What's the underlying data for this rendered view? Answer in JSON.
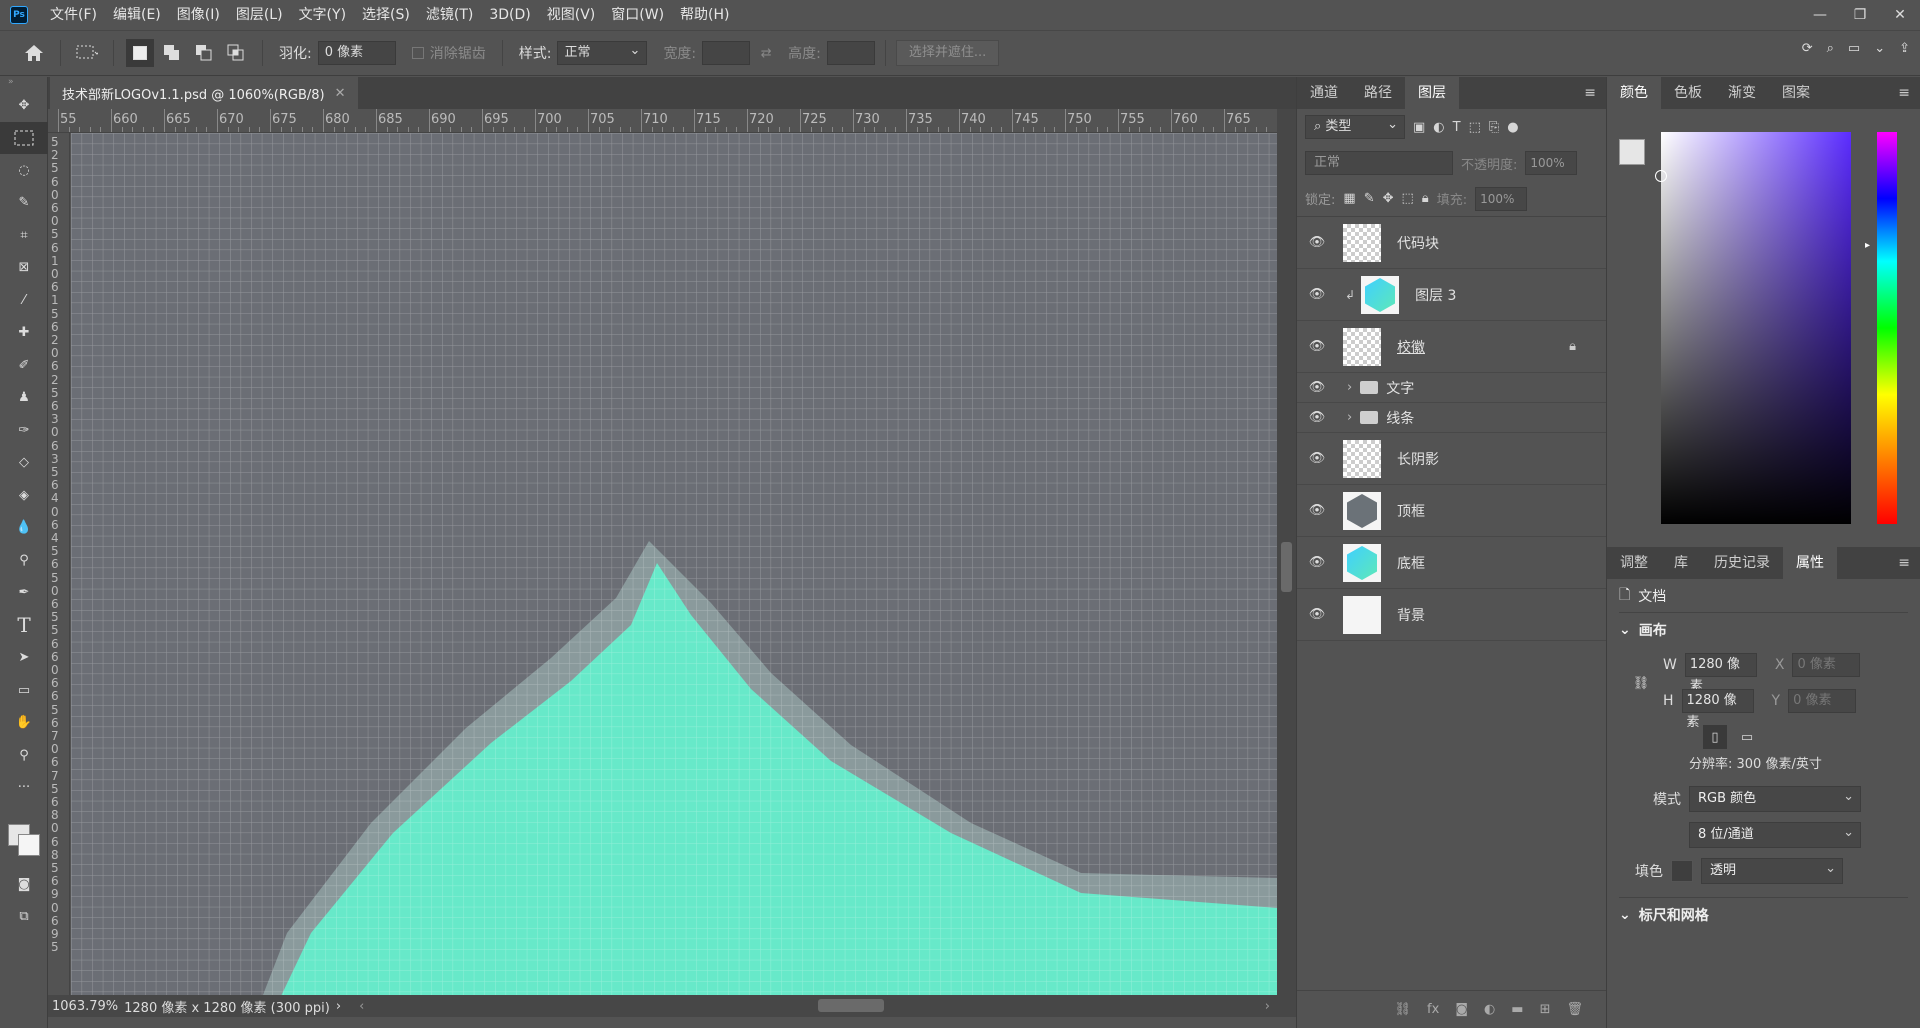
{
  "app": {
    "logo": "Ps",
    "menu": [
      "文件(F)",
      "编辑(E)",
      "图像(I)",
      "图层(L)",
      "文字(Y)",
      "选择(S)",
      "滤镜(T)",
      "3D(D)",
      "视图(V)",
      "窗口(W)",
      "帮助(H)"
    ],
    "window_controls": [
      "minimize-icon",
      "restore-icon",
      "close-icon"
    ]
  },
  "options": {
    "feather_label": "羽化:",
    "feather_value": "0 像素",
    "antialias_label": "消除锯齿",
    "style_label": "样式:",
    "style_value": "正常",
    "width_label": "宽度:",
    "height_label": "高度:",
    "select_mask_label": "选择并遮住..."
  },
  "document": {
    "tab_title": "技术部新LOGOv1.1.psd @ 1060%(RGB/8)",
    "ruler_top": [
      "55",
      "660",
      "665",
      "670",
      "675",
      "680",
      "685",
      "690",
      "695",
      "700",
      "705",
      "710",
      "715",
      "720",
      "725",
      "730",
      "735",
      "740",
      "745",
      "750",
      "755",
      "760",
      "765"
    ],
    "ruler_left": [
      "5",
      "2",
      "5",
      "6",
      "0",
      "6",
      "0",
      "5",
      "6",
      "1",
      "0",
      "6",
      "1",
      "5",
      "6",
      "2",
      "0",
      "6",
      "2",
      "5",
      "6",
      "3",
      "0",
      "6",
      "3",
      "5",
      "6",
      "4",
      "0",
      "6",
      "4",
      "5",
      "6",
      "5",
      "0",
      "6",
      "5",
      "5",
      "6",
      "6",
      "0",
      "6",
      "6",
      "5",
      "6",
      "7",
      "0",
      "6",
      "7",
      "5",
      "6",
      "8",
      "0",
      "6",
      "8",
      "5",
      "6",
      "9",
      "0",
      "6",
      "9",
      "5"
    ],
    "zoom": "1063.79%",
    "size_info": "1280 像素 x 1280 像素 (300 ppi)",
    "shape_color": "#67e9c9",
    "halo_color": "#8a9a9c",
    "background_color": "#6b6e75"
  },
  "layers_panel": {
    "tabs": [
      "通道",
      "路径",
      "图层"
    ],
    "active_tab": "图层",
    "filter_label": "类型",
    "blend_mode": "正常",
    "opacity_label": "不透明度:",
    "opacity_value": "100%",
    "lock_label": "锁定:",
    "fill_label": "填充:",
    "fill_value": "100%",
    "layers": [
      {
        "name": "代码块",
        "thumb": "checker",
        "group": false,
        "clipped": false,
        "locked": false
      },
      {
        "name": "图层 3",
        "thumb": "hex-cyan",
        "group": false,
        "clipped": true,
        "locked": false
      },
      {
        "name": "校徽",
        "thumb": "checker",
        "group": false,
        "clipped": false,
        "locked": true
      },
      {
        "name": "文字",
        "thumb": "folder",
        "group": true,
        "clipped": false,
        "locked": false
      },
      {
        "name": "线条",
        "thumb": "folder",
        "group": true,
        "clipped": false,
        "locked": false
      },
      {
        "name": "长阴影",
        "thumb": "checker",
        "group": false,
        "clipped": false,
        "locked": false
      },
      {
        "name": "顶框",
        "thumb": "hex-gray",
        "group": false,
        "clipped": false,
        "locked": false
      },
      {
        "name": "底框",
        "thumb": "hex-cyan",
        "group": false,
        "clipped": false,
        "locked": false
      },
      {
        "name": "背景",
        "thumb": "white",
        "group": false,
        "clipped": false,
        "locked": false
      }
    ]
  },
  "color_panel": {
    "tabs": [
      "颜色",
      "色板",
      "渐变",
      "图案"
    ],
    "active_tab": "颜色"
  },
  "properties_panel": {
    "tabs": [
      "调整",
      "库",
      "历史记录",
      "属性"
    ],
    "active_tab": "属性",
    "doc_label": "文档",
    "canvas_title": "画布",
    "w_label": "W",
    "w_value": "1280 像素",
    "h_label": "H",
    "h_value": "1280 像素",
    "x_label": "X",
    "x_value": "0 像素",
    "y_label": "Y",
    "y_value": "0 像素",
    "resolution": "分辨率: 300 像素/英寸",
    "mode_label": "模式",
    "mode_value": "RGB 颜色",
    "depth_value": "8 位/通道",
    "fill_label": "填色",
    "fill_value": "透明",
    "rulers_title": "标尺和网格"
  }
}
